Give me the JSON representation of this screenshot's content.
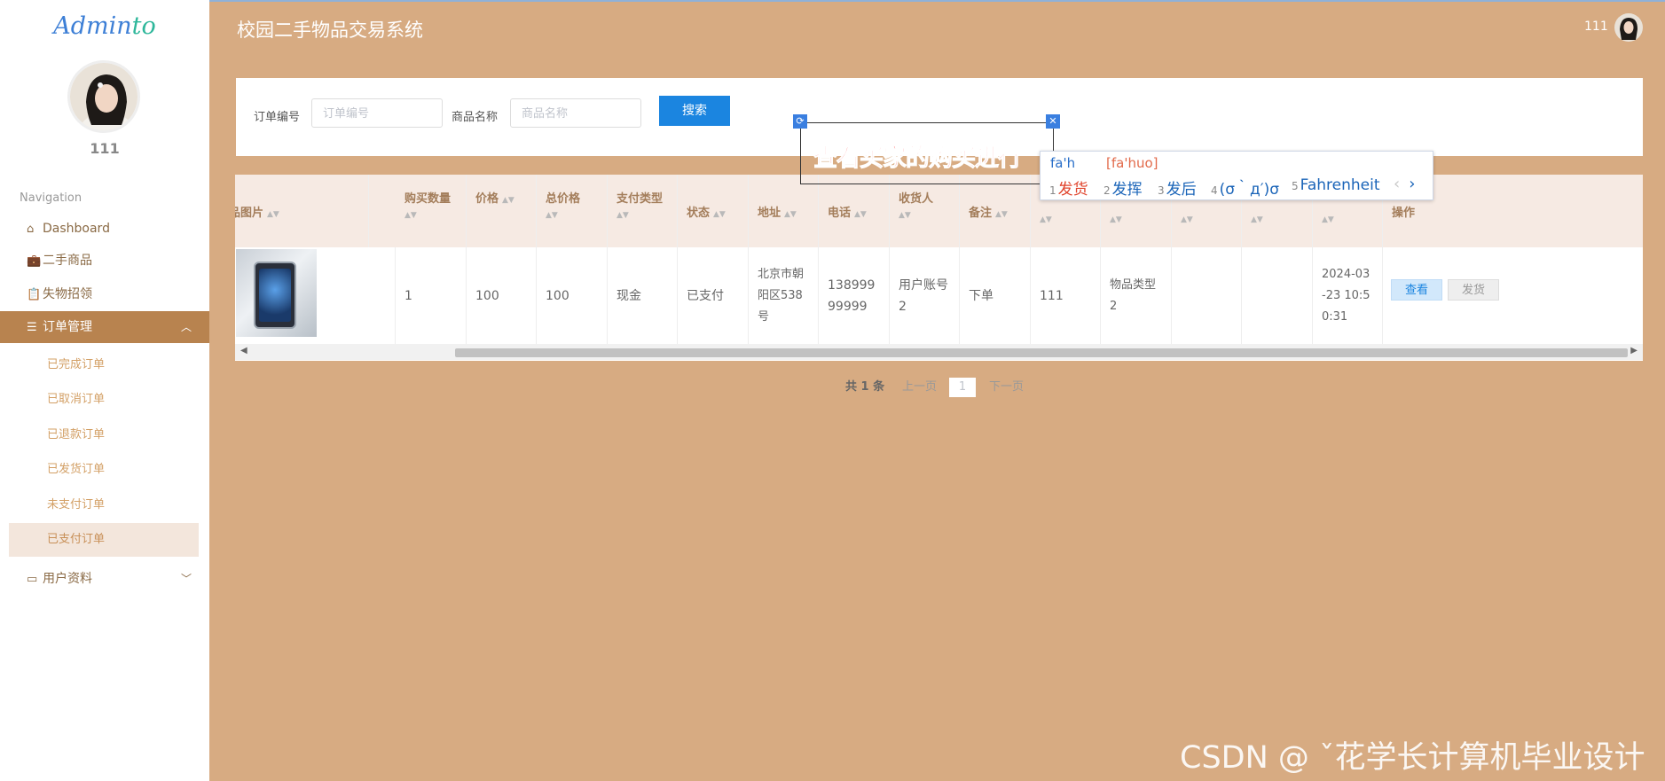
{
  "app": {
    "title": "校园二手物品交易系统",
    "logo_main": "Admin",
    "logo_accent": "to",
    "user": "111"
  },
  "sidebar": {
    "username": "111",
    "nav_title": "Navigation",
    "items": [
      {
        "label": "Dashboard",
        "icon": "home-icon"
      },
      {
        "label": "二手商品",
        "icon": "briefcase-icon"
      },
      {
        "label": "失物招领",
        "icon": "clipboard-icon"
      },
      {
        "label": "订单管理",
        "icon": "sliders-icon",
        "active": true
      }
    ],
    "subitems": [
      "已完成订单",
      "已取消订单",
      "已退款订单",
      "已发货订单",
      "未支付订单",
      "已支付订单"
    ],
    "active_subitem": "已支付订单",
    "profile_item": {
      "label": "用户资料",
      "icon": "calendar-icon"
    }
  },
  "search": {
    "order_no_label": "订单编号",
    "order_no_placeholder": "订单编号",
    "name_label": "商品名称",
    "name_placeholder": "商品名称",
    "button": "搜索"
  },
  "table": {
    "columns": [
      "商品图片",
      "购买数量",
      "价格",
      "总价格",
      "支付类型",
      "状态",
      "地址",
      "电话",
      "收货人",
      "备注",
      "",
      "",
      "",
      "",
      "",
      "操作"
    ],
    "row": {
      "quantity": "1",
      "price": "100",
      "total": "100",
      "pay_type": "现金",
      "status": "已支付",
      "address": "北京市朝阳区538号",
      "phone": "13899999999",
      "receiver": "用户账号2",
      "note": "下单",
      "user": "111",
      "category": "物品类型2",
      "time": "2024-03-23 10:50:31",
      "view_btn": "查看",
      "ship_btn": "发货"
    }
  },
  "pagination": {
    "total": "共 1 条",
    "prev": "上一页",
    "page": "1",
    "next": "下一页"
  },
  "overlay": {
    "caption": "查看买家的购买进行"
  },
  "ime": {
    "composition": "fa'h",
    "pinyin": "[fa'huo]",
    "candidates": [
      "发货",
      "发挥",
      "发后",
      "(σ｀д′)σ",
      "Fahrenheit"
    ]
  },
  "watermark": "CSDN @ ˇ花学长计算机毕业设计"
}
